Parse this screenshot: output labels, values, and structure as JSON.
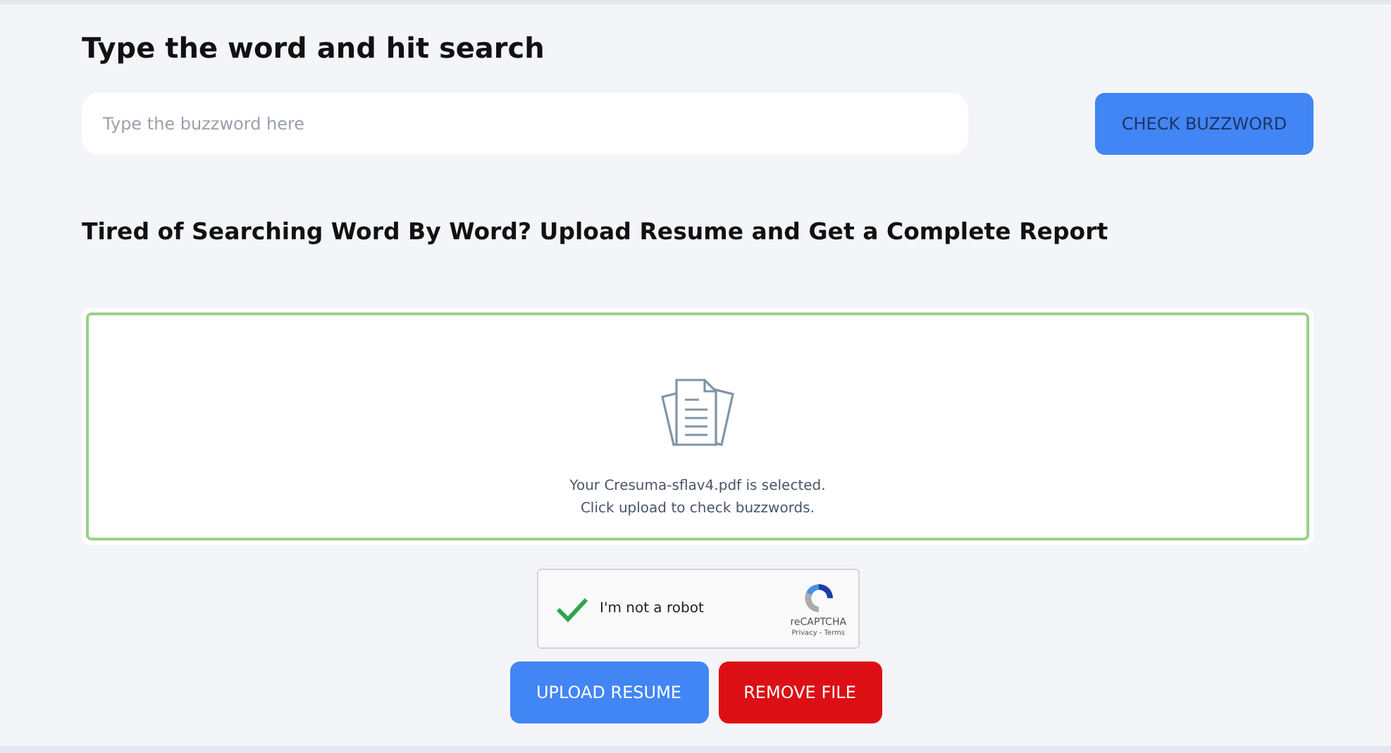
{
  "search": {
    "title": "Type the word and hit search",
    "placeholder": "Type the buzzword here",
    "button": {
      "label": "CHECK BUZZWORD",
      "disabled": true
    }
  },
  "upload": {
    "title": "Tired of Searching Word By Word? Upload Resume and Get a Complete Report",
    "file_selected": true,
    "message_lines": [
      "Your Cresuma-sflav4.pdf is selected.",
      "Click upload to check buzzwords."
    ]
  },
  "captcha": {
    "label": "I'm not a robot",
    "checked": true,
    "brand": "reCAPTCHA",
    "links": "Privacy - Terms"
  },
  "buttons": [
    {
      "kind": "primary",
      "label": "UPLOAD RESUME"
    },
    {
      "kind": "danger",
      "label": "REMOVE FILE"
    }
  ]
}
